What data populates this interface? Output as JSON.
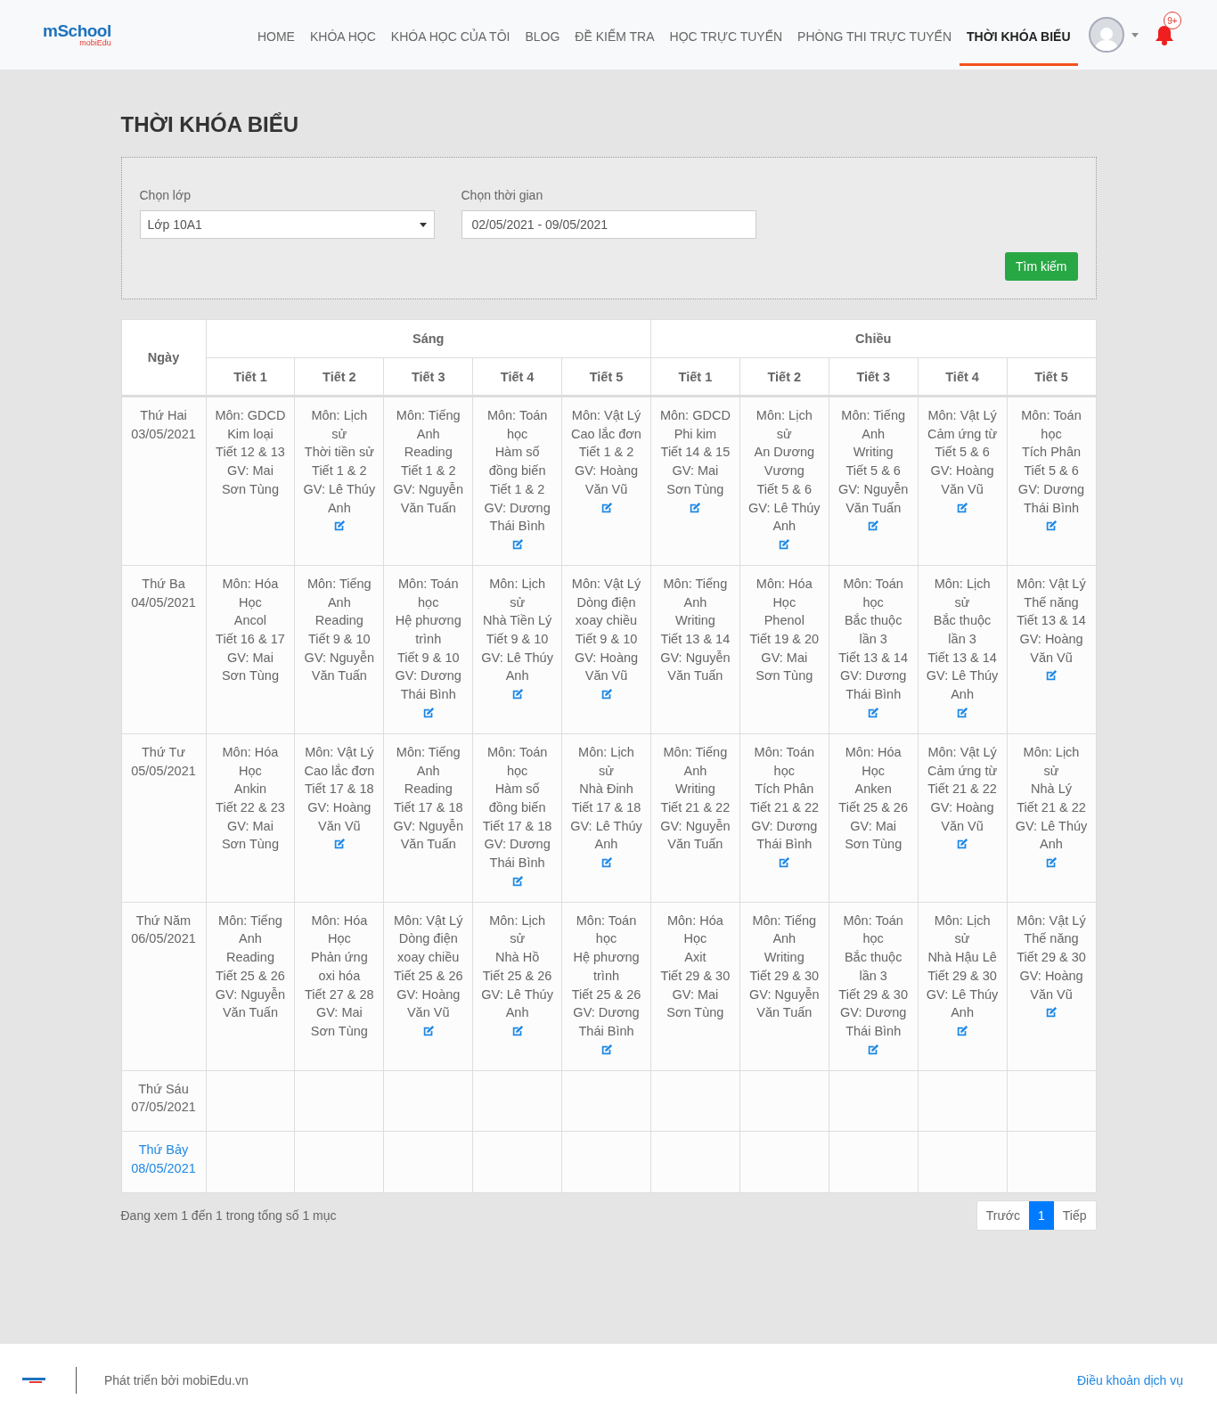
{
  "header": {
    "logo": {
      "name": "mSchool",
      "tagline": "mobiEdu"
    },
    "nav": [
      {
        "label": "HOME",
        "selected": false
      },
      {
        "label": "KHÓA HỌC",
        "selected": false
      },
      {
        "label": "KHÓA HỌC CỦA TÔI",
        "selected": false
      },
      {
        "label": "BLOG",
        "selected": false
      },
      {
        "label": "ĐỀ KIỂM TRA",
        "selected": false
      },
      {
        "label": "HỌC TRỰC TUYẾN",
        "selected": false
      },
      {
        "label": "PHÒNG THI TRỰC TUYẾN",
        "selected": false
      },
      {
        "label": "THỜI KHÓA BIỂU",
        "selected": true
      }
    ],
    "notifications": "9+"
  },
  "page_title": "THỜI KHÓA BIỂU",
  "filters": {
    "class": {
      "label": "Chọn lớp",
      "value": "Lớp 10A1"
    },
    "time": {
      "label": "Chọn thời gian",
      "value": "02/05/2021 - 09/05/2021"
    },
    "search_button": "Tìm kiếm"
  },
  "table": {
    "day_header": "Ngày",
    "sessions": [
      {
        "label": "Sáng",
        "periods": [
          "Tiết 1",
          "Tiết 2",
          "Tiết 3",
          "Tiết 4",
          "Tiết 5"
        ]
      },
      {
        "label": "Chiều",
        "periods": [
          "Tiết 1",
          "Tiết 2",
          "Tiết 3",
          "Tiết 4",
          "Tiết 5"
        ]
      }
    ],
    "rows": [
      {
        "day": "Thứ Hai",
        "date": "03/05/2021",
        "highlighted": false,
        "cells": [
          {
            "subject": "Môn: GDCD",
            "topic": "Kim loại",
            "periods": "Tiết 12 & 13",
            "teacher": "GV: Mai Sơn Tùng",
            "editable": false
          },
          {
            "subject": "Môn: Lịch sử",
            "topic": "Thời tiền sử",
            "periods": "Tiết 1 & 2",
            "teacher": "GV: Lê Thúy Anh",
            "editable": true
          },
          {
            "subject": "Môn: Tiếng Anh",
            "topic": "Reading",
            "periods": "Tiết 1 & 2",
            "teacher": "GV: Nguyễn Văn Tuấn",
            "editable": false
          },
          {
            "subject": "Môn: Toán học",
            "topic": "Hàm số đồng biến",
            "periods": "Tiết 1 & 2",
            "teacher": "GV: Dương Thái Bình",
            "editable": true
          },
          {
            "subject": "Môn: Vật Lý",
            "topic": "Cao lắc đơn",
            "periods": "Tiết 1 & 2",
            "teacher": "GV: Hoàng Văn Vũ",
            "editable": true
          },
          {
            "subject": "Môn: GDCD",
            "topic": "Phi kim",
            "periods": "Tiết 14 & 15",
            "teacher": "GV: Mai Sơn Tùng",
            "editable": true
          },
          {
            "subject": "Môn: Lịch sử",
            "topic": "An Dương Vương",
            "periods": "Tiết 5 & 6",
            "teacher": "GV: Lê Thúy Anh",
            "editable": true
          },
          {
            "subject": "Môn: Tiếng Anh",
            "topic": "Writing",
            "periods": "Tiết 5 & 6",
            "teacher": "GV: Nguyễn Văn Tuấn",
            "editable": true
          },
          {
            "subject": "Môn: Vật Lý",
            "topic": "Cảm ứng từ",
            "periods": "Tiết 5 & 6",
            "teacher": "GV: Hoàng Văn Vũ",
            "editable": true
          },
          {
            "subject": "Môn: Toán học",
            "topic": "Tích Phân",
            "periods": "Tiết 5 & 6",
            "teacher": "GV: Dương Thái Bình",
            "editable": true
          }
        ]
      },
      {
        "day": "Thứ Ba",
        "date": "04/05/2021",
        "highlighted": false,
        "cells": [
          {
            "subject": "Môn: Hóa Học",
            "topic": "Ancol",
            "periods": "Tiết 16 & 17",
            "teacher": "GV: Mai Sơn Tùng",
            "editable": false
          },
          {
            "subject": "Môn: Tiếng Anh",
            "topic": "Reading",
            "periods": "Tiết 9 & 10",
            "teacher": "GV: Nguyễn Văn Tuấn",
            "editable": false
          },
          {
            "subject": "Môn: Toán học",
            "topic": "Hệ phương trình",
            "periods": "Tiết 9 & 10",
            "teacher": "GV: Dương Thái Bình",
            "editable": true
          },
          {
            "subject": "Môn: Lịch sử",
            "topic": "Nhà Tiền Lý",
            "periods": "Tiết 9 & 10",
            "teacher": "GV: Lê Thúy Anh",
            "editable": true
          },
          {
            "subject": "Môn: Vật Lý",
            "topic": "Dòng điện xoay chiều",
            "periods": "Tiết 9 & 10",
            "teacher": "GV: Hoàng Văn Vũ",
            "editable": true
          },
          {
            "subject": "Môn: Tiếng Anh",
            "topic": "Writing",
            "periods": "Tiết 13 & 14",
            "teacher": "GV: Nguyễn Văn Tuấn",
            "editable": false
          },
          {
            "subject": "Môn: Hóa Học",
            "topic": "Phenol",
            "periods": "Tiết 19 & 20",
            "teacher": "GV: Mai Sơn Tùng",
            "editable": false
          },
          {
            "subject": "Môn: Toán học",
            "topic": "Bắc thuộc lần 3",
            "periods": "Tiết 13 & 14",
            "teacher": "GV: Dương Thái Bình",
            "editable": true
          },
          {
            "subject": "Môn: Lịch sử",
            "topic": "Bắc thuộc lần 3",
            "periods": "Tiết 13 & 14",
            "teacher": "GV: Lê Thúy Anh",
            "editable": true
          },
          {
            "subject": "Môn: Vật Lý",
            "topic": "Thế năng",
            "periods": "Tiết 13 & 14",
            "teacher": "GV: Hoàng Văn Vũ",
            "editable": true
          }
        ]
      },
      {
        "day": "Thứ Tư",
        "date": "05/05/2021",
        "highlighted": false,
        "cells": [
          {
            "subject": "Môn: Hóa Học",
            "topic": "Ankin",
            "periods": "Tiết 22 & 23",
            "teacher": "GV: Mai Sơn Tùng",
            "editable": false
          },
          {
            "subject": "Môn: Vật Lý",
            "topic": "Cao lắc đơn",
            "periods": "Tiết 17 & 18",
            "teacher": "GV: Hoàng Văn Vũ",
            "editable": true
          },
          {
            "subject": "Môn: Tiếng Anh",
            "topic": "Reading",
            "periods": "Tiết 17 & 18",
            "teacher": "GV: Nguyễn Văn Tuấn",
            "editable": false
          },
          {
            "subject": "Môn: Toán học",
            "topic": "Hàm số đồng biến",
            "periods": "Tiết 17 & 18",
            "teacher": "GV: Dương Thái Bình",
            "editable": true
          },
          {
            "subject": "Môn: Lịch sử",
            "topic": "Nhà Đinh",
            "periods": "Tiết 17 & 18",
            "teacher": "GV: Lê Thúy Anh",
            "editable": true
          },
          {
            "subject": "Môn: Tiếng Anh",
            "topic": "Writing",
            "periods": "Tiết 21 & 22",
            "teacher": "GV: Nguyễn Văn Tuấn",
            "editable": false
          },
          {
            "subject": "Môn: Toán học",
            "topic": "Tích Phân",
            "periods": "Tiết 21 & 22",
            "teacher": "GV: Dương Thái Bình",
            "editable": true
          },
          {
            "subject": "Môn: Hóa Học",
            "topic": "Anken",
            "periods": "Tiết 25 & 26",
            "teacher": "GV: Mai Sơn Tùng",
            "editable": false
          },
          {
            "subject": "Môn: Vật Lý",
            "topic": "Cảm ứng từ",
            "periods": "Tiết 21 & 22",
            "teacher": "GV: Hoàng Văn Vũ",
            "editable": true
          },
          {
            "subject": "Môn: Lịch sử",
            "topic": "Nhà Lý",
            "periods": "Tiết 21 & 22",
            "teacher": "GV: Lê Thúy Anh",
            "editable": true
          }
        ]
      },
      {
        "day": "Thứ Năm",
        "date": "06/05/2021",
        "highlighted": false,
        "cells": [
          {
            "subject": "Môn: Tiếng Anh",
            "topic": "Reading",
            "periods": "Tiết 25 & 26",
            "teacher": "GV: Nguyễn Văn Tuấn",
            "editable": false
          },
          {
            "subject": "Môn: Hóa Học",
            "topic": "Phản ứng oxi hóa",
            "periods": "Tiết 27 & 28",
            "teacher": "GV: Mai Sơn Tùng",
            "editable": false
          },
          {
            "subject": "Môn: Vật Lý",
            "topic": "Dòng điện xoay chiều",
            "periods": "Tiết 25 & 26",
            "teacher": "GV: Hoàng Văn Vũ",
            "editable": true
          },
          {
            "subject": "Môn: Lịch sử",
            "topic": "Nhà Hồ",
            "periods": "Tiết 25 & 26",
            "teacher": "GV: Lê Thúy Anh",
            "editable": true
          },
          {
            "subject": "Môn: Toán học",
            "topic": "Hệ phương trình",
            "periods": "Tiết 25 & 26",
            "teacher": "GV: Dương Thái Bình",
            "editable": true
          },
          {
            "subject": "Môn: Hóa Học",
            "topic": "Axit",
            "periods": "Tiết 29 & 30",
            "teacher": "GV: Mai Sơn Tùng",
            "editable": false
          },
          {
            "subject": "Môn: Tiếng Anh",
            "topic": "Writing",
            "periods": "Tiết 29 & 30",
            "teacher": "GV: Nguyễn Văn Tuấn",
            "editable": false
          },
          {
            "subject": "Môn: Toán học",
            "topic": "Bắc thuộc lần 3",
            "periods": "Tiết 29 & 30",
            "teacher": "GV: Dương Thái Bình",
            "editable": true
          },
          {
            "subject": "Môn: Lịch sử",
            "topic": "Nhà Hậu Lê",
            "periods": "Tiết 29 & 30",
            "teacher": "GV: Lê Thúy Anh",
            "editable": true
          },
          {
            "subject": "Môn: Vật Lý",
            "topic": "Thế năng",
            "periods": "Tiết 29 & 30",
            "teacher": "GV: Hoàng Văn Vũ",
            "editable": true
          }
        ]
      },
      {
        "day": "Thứ Sáu",
        "date": "07/05/2021",
        "highlighted": false
      },
      {
        "day": "Thứ Bảy",
        "date": "08/05/2021",
        "highlighted": true
      }
    ]
  },
  "pagination": {
    "info": "Đang xem 1 đến 1 trong tổng số 1 mục",
    "previous": "Trước",
    "pages": [
      {
        "label": "1",
        "selected": true
      }
    ],
    "next": "Tiếp"
  },
  "footer": {
    "credit": "Phát triển bởi mobiEdu.vn",
    "terms": "Điều khoản dịch vụ"
  }
}
